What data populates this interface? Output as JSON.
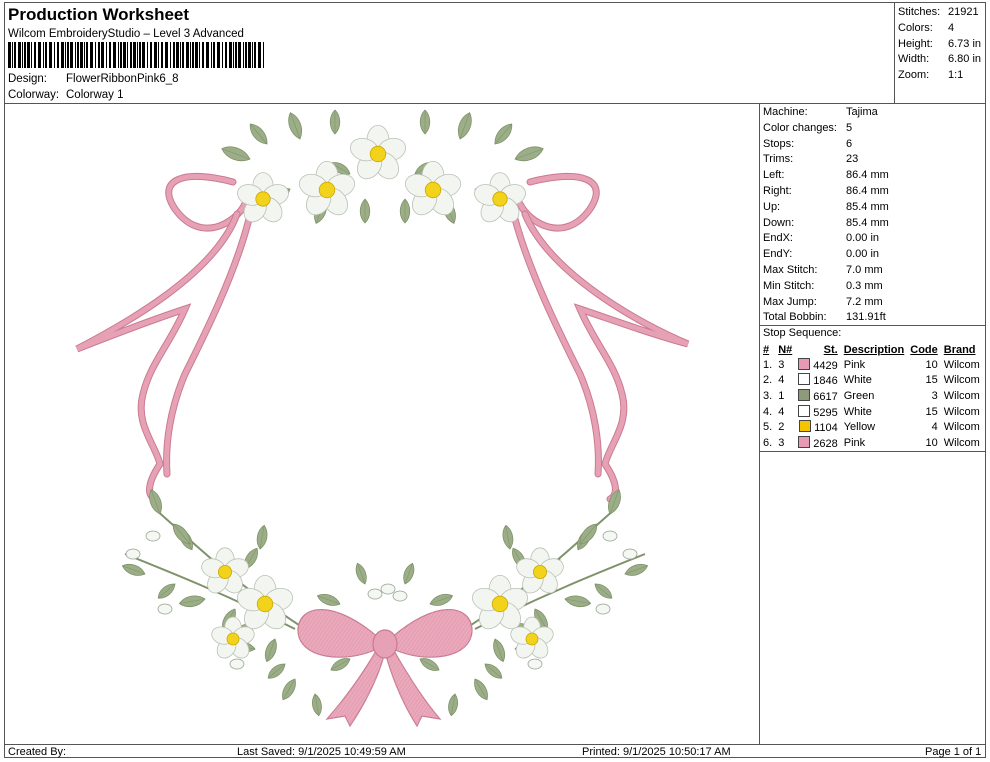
{
  "header": {
    "title": "Production Worksheet",
    "subtitle": "Wilcom EmbroideryStudio – Level 3 Advanced",
    "design_label": "Design:",
    "design_value": "FlowerRibbonPink6_8",
    "colorway_label": "Colorway:",
    "colorway_value": "Colorway 1"
  },
  "summary": [
    {
      "label": "Stitches:",
      "value": "21921"
    },
    {
      "label": "Colors:",
      "value": "4"
    },
    {
      "label": "Height:",
      "value": "6.73 in"
    },
    {
      "label": "Width:",
      "value": "6.80 in"
    },
    {
      "label": "Zoom:",
      "value": "1:1"
    }
  ],
  "machine_info": [
    {
      "label": "Machine:",
      "value": "Tajima"
    },
    {
      "label": "Color changes:",
      "value": "5"
    },
    {
      "label": "Stops:",
      "value": "6"
    },
    {
      "label": "Trims:",
      "value": "23"
    },
    {
      "label": "Left:",
      "value": "86.4 mm"
    },
    {
      "label": "Right:",
      "value": "86.4 mm"
    },
    {
      "label": "Up:",
      "value": "85.4 mm"
    },
    {
      "label": "Down:",
      "value": "85.4 mm"
    },
    {
      "label": "EndX:",
      "value": "0.00 in"
    },
    {
      "label": "EndY:",
      "value": "0.00 in"
    },
    {
      "label": "Max Stitch:",
      "value": "7.0 mm"
    },
    {
      "label": "Min Stitch:",
      "value": "0.3 mm"
    },
    {
      "label": "Max Jump:",
      "value": "7.2 mm"
    },
    {
      "label": "Total Bobbin:",
      "value": "131.91ft"
    }
  ],
  "stop_sequence": {
    "title": "Stop Sequence:",
    "columns": [
      "#",
      "N#",
      "St.",
      "Description",
      "Code",
      "Brand"
    ],
    "rows": [
      {
        "num": "1.",
        "n": "3",
        "st": "4429",
        "color": "#e79ab4",
        "desc": "Pink",
        "code": "10",
        "brand": "Wilcom"
      },
      {
        "num": "2.",
        "n": "4",
        "st": "1846",
        "color": "#ffffff",
        "desc": "White",
        "code": "15",
        "brand": "Wilcom"
      },
      {
        "num": "3.",
        "n": "1",
        "st": "6617",
        "color": "#8f9a7a",
        "desc": "Green",
        "code": "3",
        "brand": "Wilcom"
      },
      {
        "num": "4.",
        "n": "4",
        "st": "5295",
        "color": "#ffffff",
        "desc": "White",
        "code": "15",
        "brand": "Wilcom"
      },
      {
        "num": "5.",
        "n": "2",
        "st": "1104",
        "color": "#f5c400",
        "desc": "Yellow",
        "code": "4",
        "brand": "Wilcom"
      },
      {
        "num": "6.",
        "n": "3",
        "st": "2628",
        "color": "#e79ab4",
        "desc": "Pink",
        "code": "10",
        "brand": "Wilcom"
      }
    ]
  },
  "footer": {
    "created_by": "Created By:",
    "last_saved": "Last Saved: 9/1/2025 10:49:59 AM",
    "printed": "Printed: 9/1/2025 10:50:17 AM",
    "page": "Page 1 of 1"
  },
  "colors": {
    "ribbon": "#e7a1b5",
    "ribbon_dark": "#c97a92",
    "leaf": "#9cae87",
    "leaf_dark": "#7f936b",
    "petal": "#f3f6f0",
    "center": "#f2d21a"
  }
}
